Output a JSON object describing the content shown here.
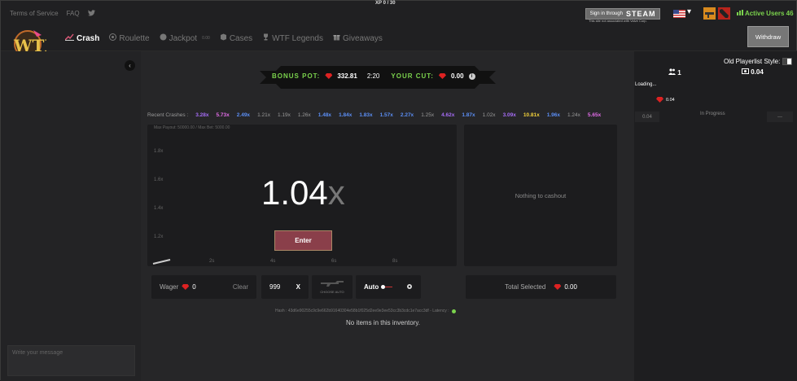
{
  "xp_label": "XP 0 / 30",
  "top_links": {
    "terms": "Terms of Service",
    "faq": "FAQ"
  },
  "steam": {
    "sign_in_text": "Sign in through",
    "brand": "STEAM",
    "note": "This site not associated with Valve Corp."
  },
  "active_users": "Active Users 46",
  "nav": {
    "crash": "Crash",
    "roulette": "Roulette",
    "jackpot": "Jackpot",
    "jackpot_amount": "0.00",
    "cases": "Cases",
    "legends": "WTF Legends",
    "giveaways": "Giveaways"
  },
  "withdraw_label": "Withdraw",
  "bonus": {
    "pot_label": "BONUS POT:",
    "pot_value": "332.81",
    "timer": "2:20",
    "cut_label": "YOUR CUT:",
    "cut_value": "0.00"
  },
  "recent_crashes_label": "Recent Crashes :",
  "recent_crashes": [
    {
      "v": "3.28x",
      "c": "#a56cf5"
    },
    {
      "v": "5.73x",
      "c": "#e06ce6"
    },
    {
      "v": "2.49x",
      "c": "#5b8ef5"
    },
    {
      "v": "1.21x",
      "c": "#999999"
    },
    {
      "v": "1.19x",
      "c": "#999999"
    },
    {
      "v": "1.26x",
      "c": "#999999"
    },
    {
      "v": "1.48x",
      "c": "#5b8ef5"
    },
    {
      "v": "1.84x",
      "c": "#5b8ef5"
    },
    {
      "v": "1.83x",
      "c": "#5b8ef5"
    },
    {
      "v": "1.57x",
      "c": "#5b8ef5"
    },
    {
      "v": "2.27x",
      "c": "#5b8ef5"
    },
    {
      "v": "1.25x",
      "c": "#999999"
    },
    {
      "v": "4.62x",
      "c": "#a56cf5"
    },
    {
      "v": "1.87x",
      "c": "#5b8ef5"
    },
    {
      "v": "1.02x",
      "c": "#999999"
    },
    {
      "v": "3.09x",
      "c": "#a56cf5"
    },
    {
      "v": "10.81x",
      "c": "#f2d13a"
    },
    {
      "v": "1.96x",
      "c": "#5b8ef5"
    },
    {
      "v": "1.24x",
      "c": "#999999"
    },
    {
      "v": "5.65x",
      "c": "#e06ce6"
    }
  ],
  "graph": {
    "payout_note": "Max Payout: 50000.00 / Max Bet: 5000.00",
    "y_ticks": [
      "1.8x",
      "1.6x",
      "1.4x",
      "1.2x"
    ],
    "x_ticks": [
      "2s",
      "4s",
      "6s",
      "8s"
    ],
    "multiplier": "1.04",
    "multiplier_suffix": "x"
  },
  "enter_label": "Enter",
  "cashout_empty": "Nothing to cashout",
  "wager": {
    "label": "Wager",
    "value": "0",
    "clear": "Clear"
  },
  "autocash": {
    "value": "999",
    "x": "X",
    "choose_label": "CHOOSE AUTO"
  },
  "auto_label": "Auto",
  "total_selected": {
    "label": "Total Selected",
    "value": "0.00"
  },
  "hash_text": "Hash : 43d6e90255c9c9e662b91640304e58b1f025d2ee9e3ee53cc3b3cdc1e7acc3df - Latency :",
  "no_items": "No items in this inventory.",
  "chat_placeholder": "Write your message",
  "right": {
    "old_style_label": "Old Playerlist Style:",
    "users": "1",
    "amount": "0.04",
    "loading": "Loading...",
    "gem_value": "0.04",
    "row_value": "0.04",
    "row_status": "In Progress",
    "row_more": "---"
  }
}
